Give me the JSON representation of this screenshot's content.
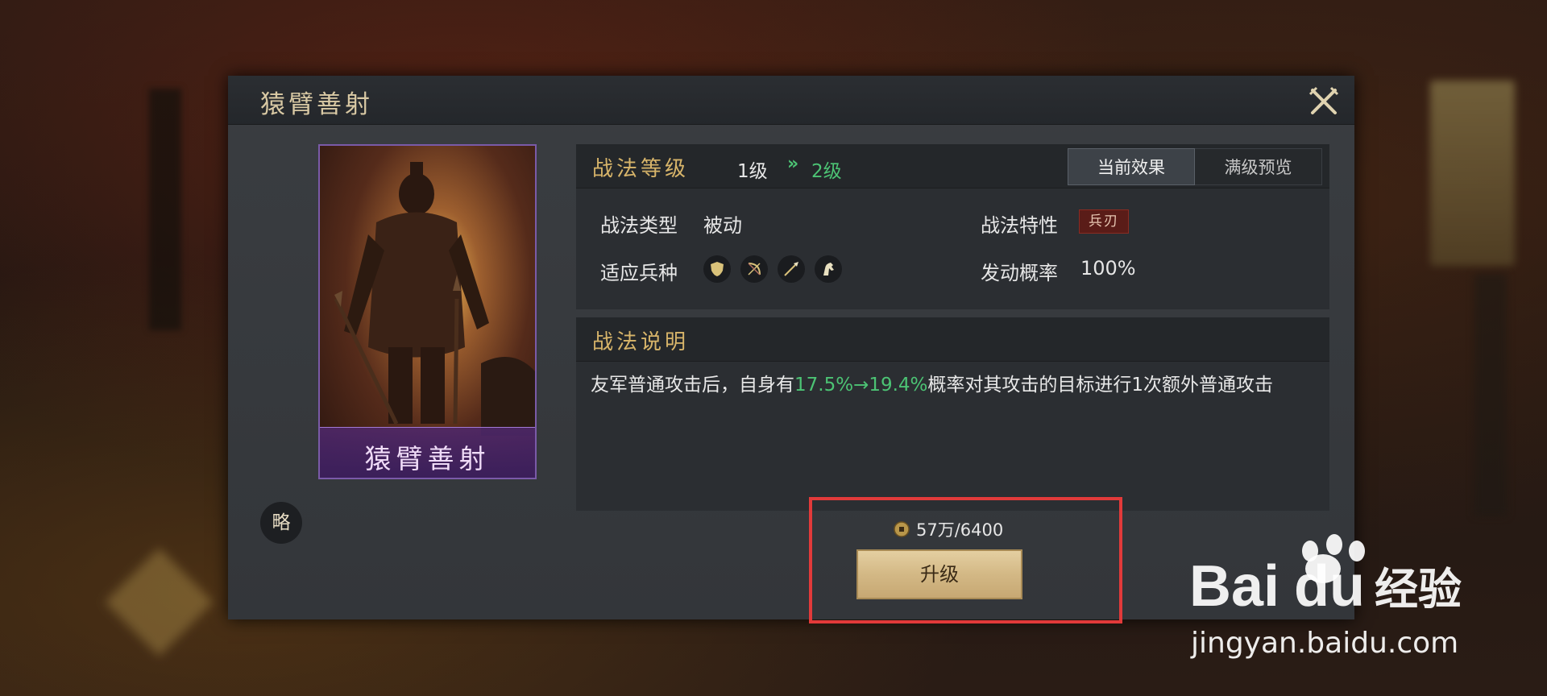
{
  "dialog": {
    "title": "猿臂善射",
    "close_icon": "close-crossed-swords-icon"
  },
  "card": {
    "name": "猿臂善射",
    "rarity_color": "#7a5aa8",
    "badge": "略"
  },
  "level": {
    "label": "战法等级",
    "from": "1级",
    "arrow": "»",
    "to": "2级"
  },
  "tabs": {
    "current": "当前效果",
    "max_preview": "满级预览",
    "active": "current"
  },
  "info": {
    "type_label": "战法类型",
    "type_value": "被动",
    "trait_label": "战法特性",
    "trait_value": "兵刃",
    "troops_label": "适应兵种",
    "troops": [
      "shield-troop-icon",
      "bow-troop-icon",
      "spear-troop-icon",
      "cavalry-troop-icon"
    ],
    "chance_label": "发动概率",
    "chance_value": "100%"
  },
  "description": {
    "title": "战法说明",
    "pre": "友军普通攻击后，自身有",
    "highlight": "17.5%→19.4%",
    "post": "概率对其攻击的目标进行1次额外普通攻击"
  },
  "upgrade": {
    "coin_icon": "copper-coin-icon",
    "cost": "57万/6400",
    "button": "升级"
  },
  "colors": {
    "accent_gold": "#d8b56a",
    "highlight_green": "#4cc374",
    "annotation_red": "#e23a3a"
  },
  "watermark": {
    "brand_text": "jingyan.baidu.com",
    "logo_lettering": "Bai du 经验"
  }
}
